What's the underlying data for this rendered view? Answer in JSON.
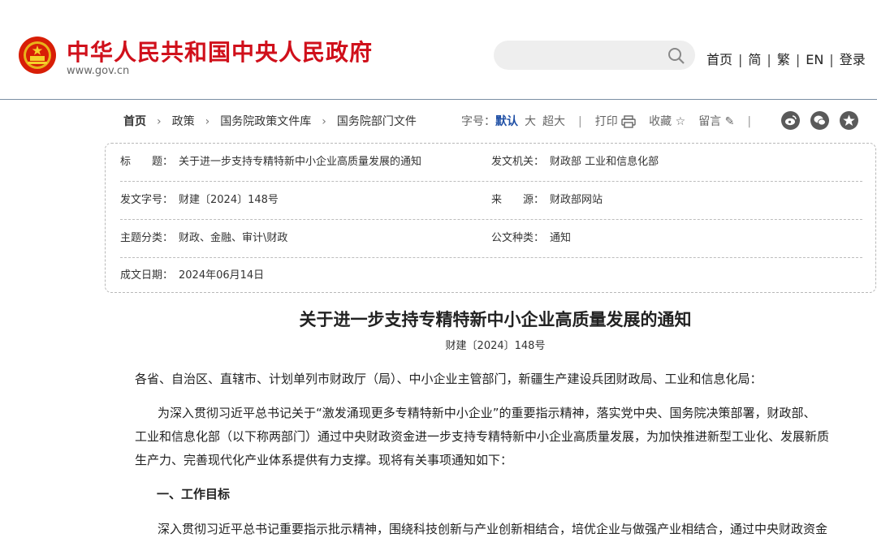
{
  "header": {
    "site_title": "中华人民共和国中央人民政府",
    "site_url": "www.gov.cn",
    "nav": [
      "首页",
      "简",
      "繁",
      "EN",
      "登录"
    ]
  },
  "breadcrumb": [
    "首页",
    "政策",
    "国务院政策文件库",
    "国务院部门文件"
  ],
  "toolbar": {
    "font_label": "字号：",
    "font_sizes": [
      "默认",
      "大",
      "超大"
    ],
    "print": "打印",
    "favorite": "收藏",
    "comment": "留言",
    "share_icons": [
      "weibo-icon",
      "wechat-icon",
      "star-icon"
    ]
  },
  "meta": {
    "title_label": "标　　题：",
    "title_value": "关于进一步支持专精特新中小企业高质量发展的通知",
    "issuer_label": "发文机关：",
    "issuer_value": "财政部 工业和信息化部",
    "docno_label": "发文字号：",
    "docno_value": "财建〔2024〕148号",
    "source_label": "来　　源：",
    "source_value": "财政部网站",
    "topic_label": "主题分类：",
    "topic_value": "财政、金融、审计\\财政",
    "type_label": "公文种类：",
    "type_value": "通知",
    "date_label": "成文日期：",
    "date_value": "2024年06月14日"
  },
  "document": {
    "title": "关于进一步支持专精特新中小企业高质量发展的通知",
    "number": "财建〔2024〕148号",
    "recipients": "各省、自治区、直辖市、计划单列市财政厅（局）、中小企业主管部门，新疆生产建设兵团财政局、工业和信息化局：",
    "para1_line1": "为深入贯彻习近平总书记关于“激发涌现更多专精特新中小企业”的重要指示精神，落实党中央、国务院决策部署，财政部、",
    "para1_line2": "工业和信息化部（以下称两部门）通过中央财政资金进一步支持专精特新中小企业高质量发展，为加快推进新型工业化、发展新质",
    "para1_line3": "生产力、完善现代化产业体系提供有力支撑。现将有关事项通知如下：",
    "heading1": "一、工作目标",
    "para2_line1": "深入贯彻习近平总书记重要指示批示精神，围绕科技创新与产业创新相结合，培优企业与做强产业相结合，通过中央财政资金"
  },
  "colors": {
    "brand_red": "#d0101b",
    "accent_blue": "#1f4fa5"
  }
}
